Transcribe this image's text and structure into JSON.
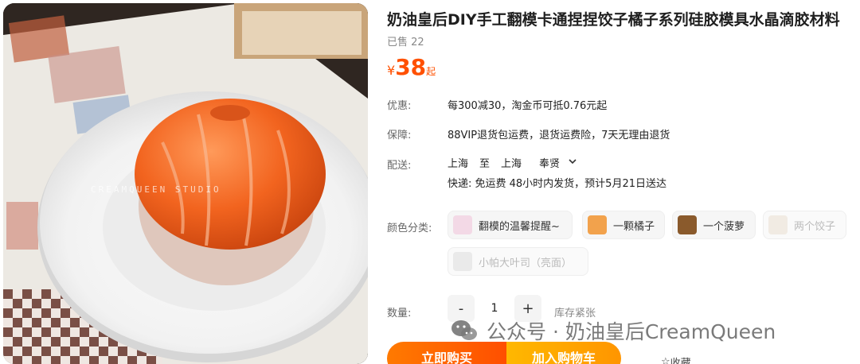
{
  "product": {
    "title": "奶油皇后DIY手工翻模卡通捏捏饺子橘子系列硅胶模具水晶滴胶材料",
    "sold": "已售 22",
    "price_currency": "¥",
    "price_value": "38",
    "price_suffix": "起",
    "image_caption": "CREAMQUEEN STUDIO"
  },
  "rows": {
    "promo_label": "优惠:",
    "promo_value": "每300减30，淘金币可抵0.76元起",
    "guarantee_label": "保障:",
    "guarantee_value": "88VIP退货包运费，退货运费险，7天无理由退货",
    "delivery_label": "配送:",
    "delivery_from": "上海",
    "delivery_to_word": "至",
    "delivery_to": "上海",
    "delivery_district": "奉贤",
    "shipping_line": "快递: 免运费   48小时内发货，预计5月21日送达",
    "color_label": "颜色分类:",
    "qty_label": "数量:"
  },
  "options": [
    {
      "label": "翻模的温馨提醒~",
      "thumb_color": "#f3d9e6",
      "disabled": false
    },
    {
      "label": "一颗橘子",
      "thumb_color": "#f2a24c",
      "disabled": false
    },
    {
      "label": "一个菠萝",
      "thumb_color": "#8a5a2c",
      "disabled": false
    },
    {
      "label": "两个饺子",
      "thumb_color": "#e8dccc",
      "disabled": true
    },
    {
      "label": "小帕大叶司（亮面）",
      "thumb_color": "#d9d9d9",
      "disabled": true
    }
  ],
  "quantity": {
    "minus": "-",
    "value": "1",
    "plus": "+",
    "stock": "库存紧张"
  },
  "actions": {
    "buy": "立即购买",
    "cart": "加入购物车",
    "favorite": "收藏",
    "favorite_icon": "☆"
  },
  "watermark": "公众号 · 奶油皇后CreamQueen",
  "colors": {
    "accent": "#ff5000",
    "buy_start": "#ff7a00",
    "cart_end": "#ff9500"
  }
}
